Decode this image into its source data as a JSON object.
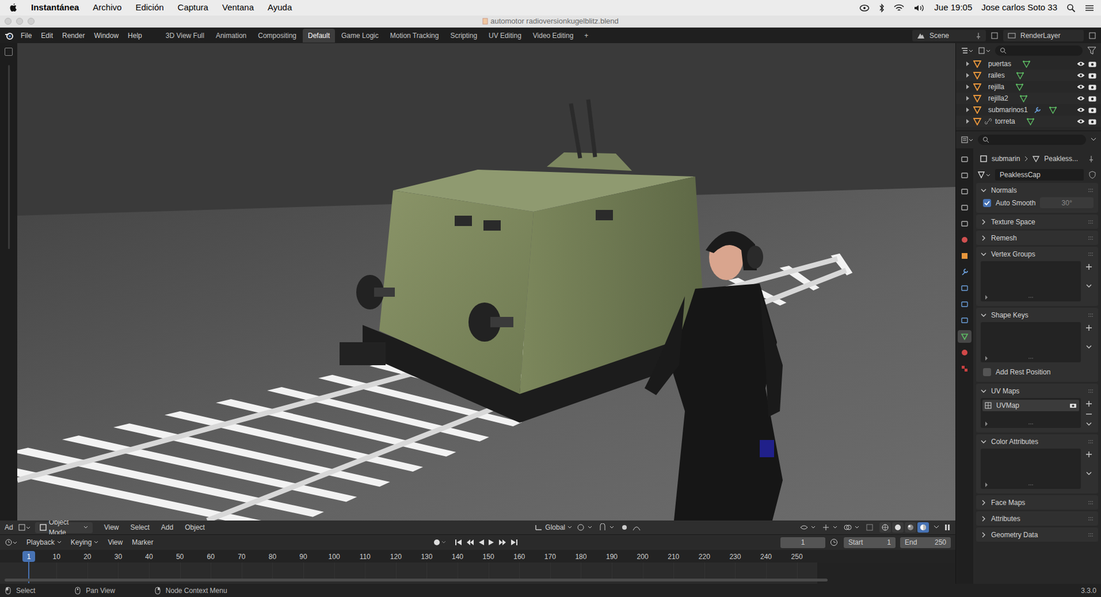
{
  "menubar": {
    "app": "Instantánea",
    "items": [
      "Archivo",
      "Edición",
      "Captura",
      "Ventana",
      "Ayuda"
    ],
    "clock": "Jue 19:05",
    "user": "Jose carlos Soto 33"
  },
  "window": {
    "title": "automotor radioversionkugelblitz.blend"
  },
  "topbar": {
    "menus": [
      "File",
      "Edit",
      "Render",
      "Window",
      "Help"
    ],
    "workspaces": [
      {
        "label": "3D View Full",
        "selected": false
      },
      {
        "label": "Animation",
        "selected": false
      },
      {
        "label": "Compositing",
        "selected": false
      },
      {
        "label": "Default",
        "selected": true
      },
      {
        "label": "Game Logic",
        "selected": false
      },
      {
        "label": "Motion Tracking",
        "selected": false
      },
      {
        "label": "Scripting",
        "selected": false
      },
      {
        "label": "UV Editing",
        "selected": false
      },
      {
        "label": "Video Editing",
        "selected": false
      }
    ],
    "add_tab": "+",
    "scene": "Scene",
    "view_layer": "RenderLayer"
  },
  "viewport": {
    "editor_label": "Ad",
    "mode": "Object Mode",
    "menus": [
      "View",
      "Select",
      "Add",
      "Object"
    ],
    "orientation": "Global",
    "shading": [
      {
        "kind": "wireframe",
        "selected": false
      },
      {
        "kind": "solid",
        "selected": false
      },
      {
        "kind": "material",
        "selected": false
      },
      {
        "kind": "rendered",
        "selected": true
      }
    ]
  },
  "timeline": {
    "menus": [
      "Playback",
      "Keying",
      "View",
      "Marker"
    ],
    "current_frame": "1",
    "start_label": "Start",
    "start": "1",
    "end_label": "End",
    "end": "250",
    "playhead": "1",
    "ticks": [
      "10",
      "20",
      "30",
      "40",
      "50",
      "60",
      "70",
      "80",
      "90",
      "100",
      "110",
      "120",
      "130",
      "140",
      "150",
      "160",
      "170",
      "180",
      "190",
      "200",
      "210",
      "220",
      "230",
      "240",
      "250"
    ]
  },
  "outliner": {
    "items": [
      {
        "name": "puertas",
        "expanded": false,
        "has_modifier": false,
        "parented": false,
        "visible": true,
        "renderable": true
      },
      {
        "name": "railes",
        "expanded": false,
        "has_modifier": false,
        "parented": false,
        "visible": true,
        "renderable": true
      },
      {
        "name": "rejilla",
        "expanded": false,
        "has_modifier": false,
        "parented": false,
        "visible": true,
        "renderable": true
      },
      {
        "name": "rejilla2",
        "expanded": false,
        "has_modifier": false,
        "parented": false,
        "visible": true,
        "renderable": true
      },
      {
        "name": "submarinos1",
        "expanded": false,
        "has_modifier": true,
        "parented": false,
        "visible": true,
        "renderable": true
      },
      {
        "name": "torreta",
        "expanded": false,
        "has_modifier": false,
        "parented": true,
        "visible": true,
        "renderable": true
      }
    ]
  },
  "properties": {
    "tabs": [
      {
        "kind": "tool",
        "color": "#b0b0b0",
        "selected": false
      },
      {
        "kind": "render",
        "color": "#b0b0b0",
        "selected": false
      },
      {
        "kind": "output",
        "color": "#b0b0b0",
        "selected": false
      },
      {
        "kind": "view-layer",
        "color": "#b0b0b0",
        "selected": false
      },
      {
        "kind": "scene",
        "color": "#b0b0b0",
        "selected": false
      },
      {
        "kind": "world",
        "color": "#d05050",
        "selected": false
      },
      {
        "kind": "object",
        "color": "#e8963c",
        "selected": false
      },
      {
        "kind": "modifiers",
        "color": "#6ca0dc",
        "selected": false
      },
      {
        "kind": "particles",
        "color": "#6ca0dc",
        "selected": false
      },
      {
        "kind": "physics",
        "color": "#6ca0dc",
        "selected": false
      },
      {
        "kind": "constraints",
        "color": "#6ca0dc",
        "selected": false
      },
      {
        "kind": "data",
        "color": "#5dbb63",
        "selected": true
      },
      {
        "kind": "material",
        "color": "#d04848",
        "selected": false
      },
      {
        "kind": "texture",
        "color": "#c84040",
        "selected": false
      }
    ],
    "breadcrumb": [
      "submarin",
      "Peakless..."
    ],
    "data_name": "PeaklessCap",
    "sections": [
      {
        "title": "Normals",
        "expanded": true,
        "kind": "normals",
        "items": [],
        "options": [
          {
            "label": "Auto Smooth",
            "checked": true
          }
        ],
        "value": "30°"
      },
      {
        "title": "Texture Space",
        "expanded": false,
        "kind": "header",
        "items": [],
        "options": []
      },
      {
        "title": "Remesh",
        "expanded": false,
        "kind": "header",
        "items": [],
        "options": []
      },
      {
        "title": "Vertex Groups",
        "expanded": true,
        "kind": "list",
        "items": [],
        "options": []
      },
      {
        "title": "Shape Keys",
        "expanded": true,
        "kind": "list",
        "items": [],
        "options": [
          {
            "label": "Add Rest Position",
            "checked": false
          }
        ]
      },
      {
        "title": "UV Maps",
        "expanded": true,
        "kind": "list",
        "items": [
          "UVMap"
        ],
        "options": []
      },
      {
        "title": "Color Attributes",
        "expanded": true,
        "kind": "list",
        "items": [],
        "options": []
      },
      {
        "title": "Face Maps",
        "expanded": false,
        "kind": "header",
        "items": [],
        "options": []
      },
      {
        "title": "Attributes",
        "expanded": false,
        "kind": "header",
        "items": [],
        "options": []
      },
      {
        "title": "Geometry Data",
        "expanded": false,
        "kind": "header",
        "items": [],
        "options": []
      }
    ]
  },
  "statusbar": {
    "hints": [
      "Select",
      "Pan View",
      "Node Context Menu"
    ],
    "version": "3.3.0"
  }
}
